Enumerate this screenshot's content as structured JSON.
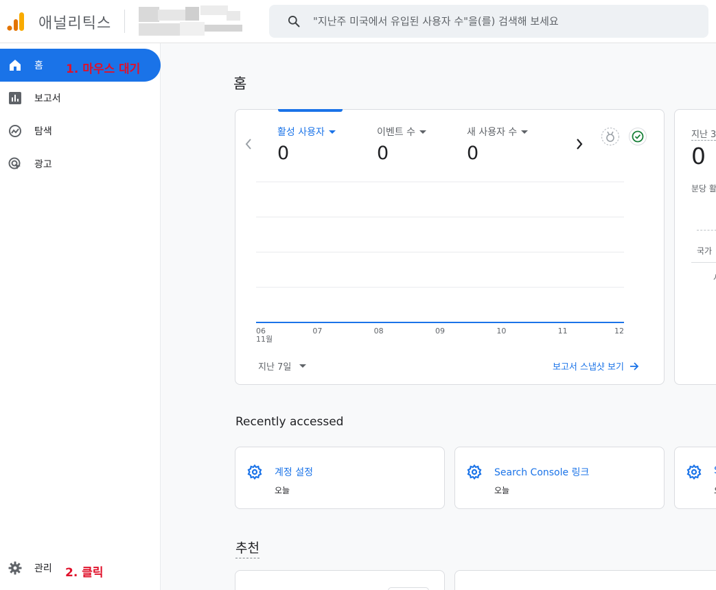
{
  "header": {
    "app_title": "애널리틱스",
    "search_placeholder": "\"지난주 미국에서 유입된 사용자 수\"을(를) 검색해 보세요"
  },
  "sidebar": {
    "items": [
      {
        "label": "홈",
        "icon": "home-icon",
        "active": true
      },
      {
        "label": "보고서",
        "icon": "bar-chart-icon"
      },
      {
        "label": "탐색",
        "icon": "explore-icon"
      },
      {
        "label": "광고",
        "icon": "ads-icon"
      }
    ],
    "admin_label": "관리"
  },
  "annotations": {
    "hover": "1. 마우스 대기",
    "click": "2. 클릭"
  },
  "main": {
    "page_title": "홈",
    "metrics": [
      {
        "label": "활성 사용자",
        "value": "0"
      },
      {
        "label": "이벤트 수",
        "value": "0"
      },
      {
        "label": "새 사용자 수",
        "value": "0"
      }
    ],
    "date_range": "지난 7일",
    "snapshot_link": "보고서 스냅샷 보기",
    "realtime": {
      "title": "지난 3",
      "value": "0",
      "subtitle": "분당 활",
      "country": "국가",
      "fragment": "사"
    },
    "recent_title": "Recently accessed",
    "recent": [
      {
        "title": "계정 설정",
        "sub": "오늘"
      },
      {
        "title": "Search Console 링크",
        "sub": "오늘"
      },
      {
        "title": "S",
        "sub": "오"
      }
    ],
    "recommend_title": "추천"
  },
  "colors": {
    "accent": "#1a73e8",
    "annotation": "#e0102a",
    "logo_orange": "#f9ab00",
    "logo_dark": "#e37400"
  },
  "chart_data": {
    "type": "line",
    "x": [
      "06",
      "07",
      "08",
      "09",
      "10",
      "11",
      "12"
    ],
    "x_sublabel": "11월",
    "series": [
      {
        "values": [
          0,
          0,
          0,
          0,
          0,
          0,
          0
        ]
      }
    ],
    "ylim": [
      0,
      4
    ],
    "grid": true
  }
}
